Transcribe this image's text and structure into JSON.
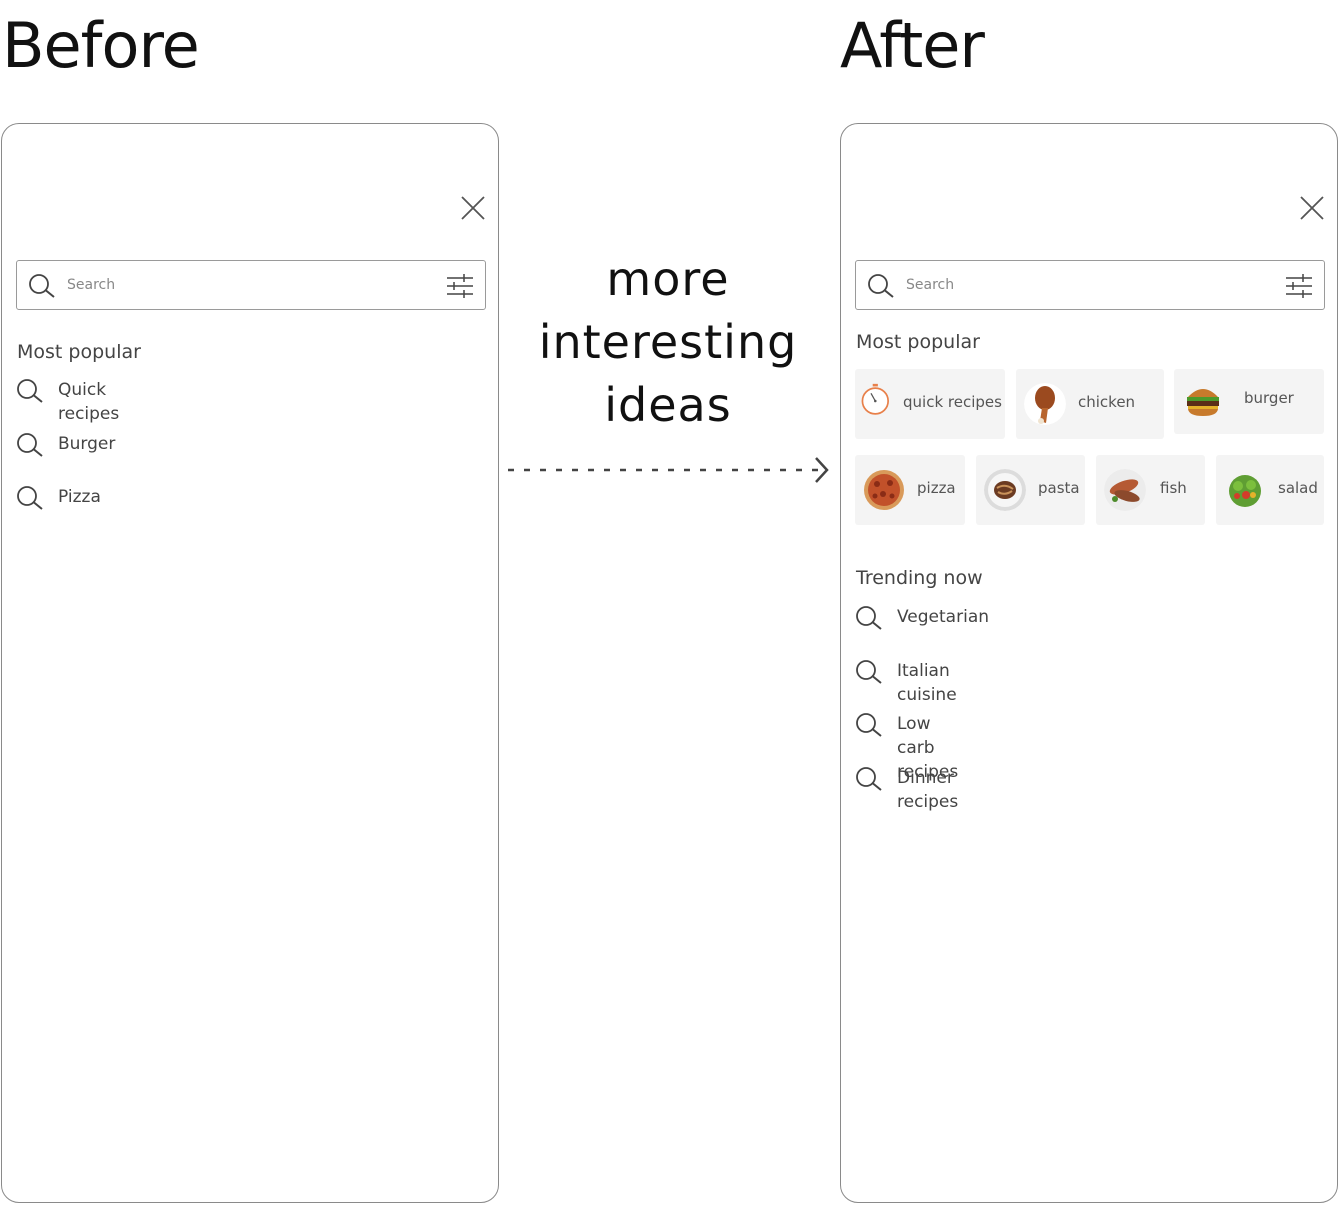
{
  "before": {
    "title": "Before",
    "search": {
      "placeholder": "Search"
    },
    "most_popular": {
      "title": "Most popular",
      "items": [
        "Quick recipes",
        "Burger",
        "Pizza"
      ]
    }
  },
  "middle": {
    "lines": [
      "more",
      "interesting",
      "ideas"
    ]
  },
  "after": {
    "title": "After",
    "search": {
      "placeholder": "Search"
    },
    "most_popular": {
      "title": "Most popular",
      "chips": [
        {
          "label": "quick recipes",
          "icon": "stopwatch-icon"
        },
        {
          "label": "chicken",
          "icon": "chicken-image"
        },
        {
          "label": "burger",
          "icon": "burger-image"
        },
        {
          "label": "pizza",
          "icon": "pizza-image"
        },
        {
          "label": "pasta",
          "icon": "pasta-image"
        },
        {
          "label": "fish",
          "icon": "fish-image"
        },
        {
          "label": "salad",
          "icon": "salad-image"
        }
      ]
    },
    "trending": {
      "title": "Trending now",
      "items": [
        "Vegetarian",
        "Italian cuisine",
        "Low carb recipes",
        "Dinner recipes"
      ]
    }
  },
  "colors": {
    "border": "#8a8a8a",
    "chip_bg": "#f4f4f4",
    "timer_orange": "#e8804a",
    "text": "#444444"
  }
}
